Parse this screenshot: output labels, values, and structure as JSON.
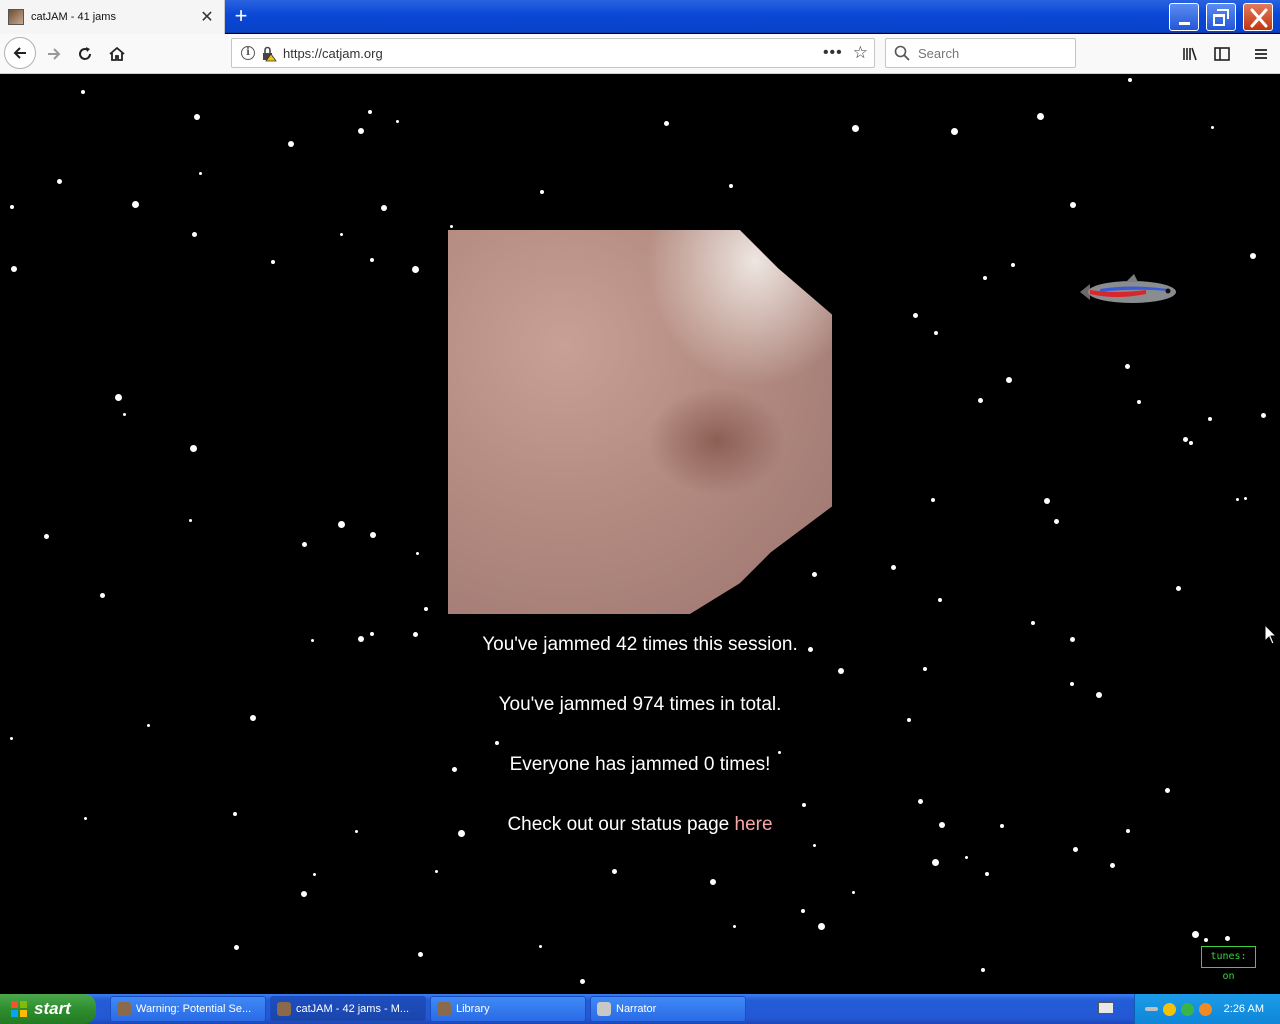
{
  "browser": {
    "tab_title": "catJAM - 41 jams",
    "new_tab": "+",
    "url": "https://catjam.org",
    "search_placeholder": "Search"
  },
  "page": {
    "session_line": "You've jammed 42 times this session.",
    "total_line": "You've jammed 974 times in total.",
    "everyone_line": "Everyone has jammed 0 times!",
    "status_prefix": "Check out our status page ",
    "status_link": "here",
    "tunes_toggle": "tunes: on"
  },
  "taskbar": {
    "start_label": "start",
    "tasks": [
      {
        "label": "Warning: Potential Se..."
      },
      {
        "label": "catJAM - 42 jams - M..."
      },
      {
        "label": "Library"
      },
      {
        "label": "Narrator"
      }
    ],
    "clock": "2:26 AM"
  },
  "colors": {
    "page_background": "#000000",
    "link": "#f6a7a7",
    "tunes": "#3ecf3e",
    "titlebar": "#0a48d6"
  },
  "icons": [
    "back-icon",
    "forward-icon",
    "reload-icon",
    "home-icon",
    "info-icon",
    "lock-warning-icon",
    "more-icon",
    "bookmark-star-icon",
    "search-icon",
    "library-icon",
    "sidebar-icon",
    "menu-icon",
    "fish-icon",
    "cursor-icon"
  ]
}
